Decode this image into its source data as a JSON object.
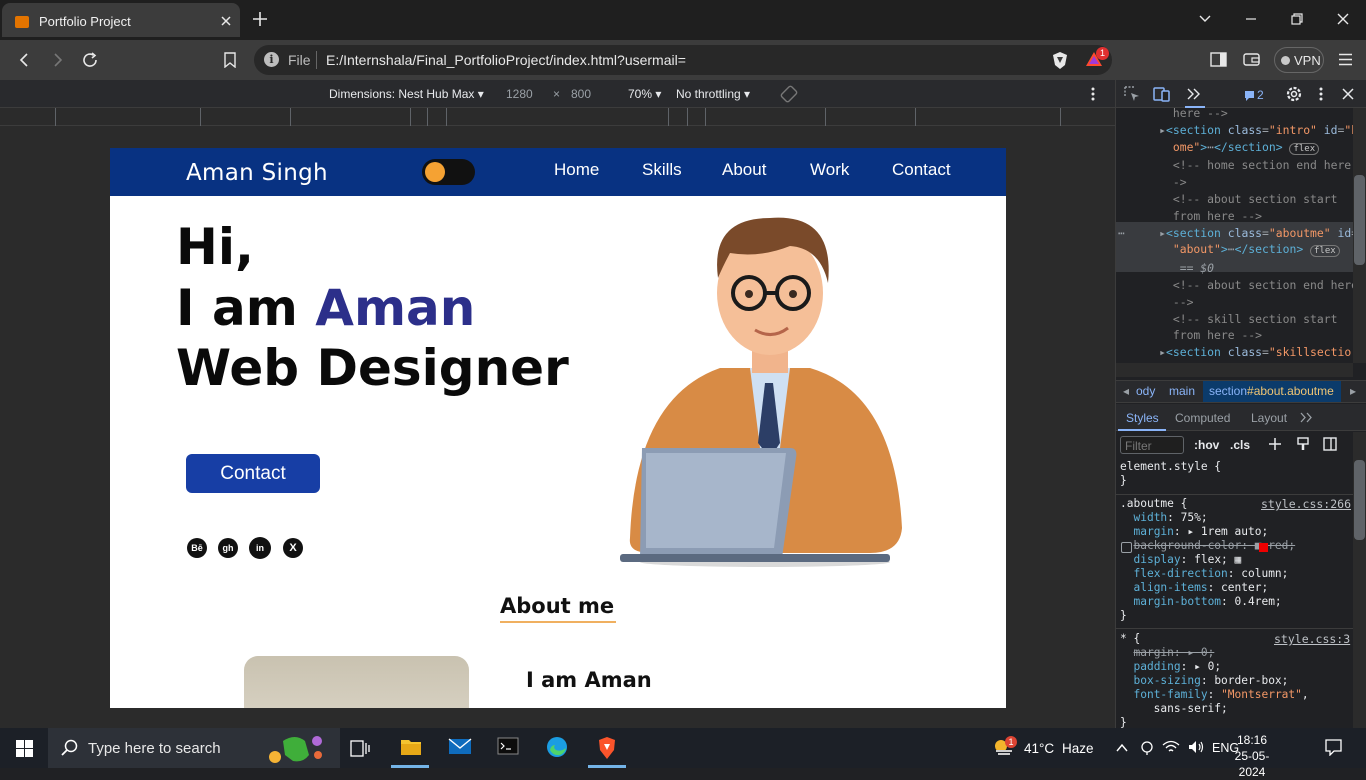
{
  "browser": {
    "tab_title": "Portfolio Project",
    "url_scheme": "File",
    "url": "E:/Internshala/Final_PortfolioProject/index.html?usermail=",
    "rewards_badge": "1",
    "vpn_label": "VPN"
  },
  "device_toolbar": {
    "dimensions_label": "Dimensions: Nest Hub Max",
    "width": "1280",
    "times": "×",
    "height": "800",
    "zoom": "70%",
    "throttling": "No throttling"
  },
  "site": {
    "logo": "Aman Singh",
    "nav": [
      "Home",
      "Skills",
      "About",
      "Work",
      "Contact"
    ],
    "hero_hi": "Hi,",
    "hero_iam_prefix": "I am ",
    "hero_name": "Aman",
    "hero_role": "Web Designer",
    "contact_button": "Contact",
    "social_icons": [
      "Bē",
      "gh",
      "in",
      "X"
    ],
    "about_heading": "About me",
    "about_subheading": "I am Aman"
  },
  "devtools": {
    "issues_count": "2",
    "breadcrumbs": [
      "ody",
      "main",
      "section",
      "#about.aboutme"
    ],
    "tabs": [
      "Styles",
      "Computed",
      "Layout"
    ],
    "filter_placeholder": "Filter",
    "hov": ":hov",
    "cls": ".cls",
    "dom_selected_marker": "== $0",
    "element_style": "element.style {",
    "rule1_selector": ".aboutme {",
    "rule1_source": "style.css:266",
    "rule2_selector": "* {",
    "rule2_source": "style.css:3"
  },
  "taskbar": {
    "search_placeholder": "Type here to search",
    "weather_temp": "41°C",
    "weather_desc": "Haze",
    "lang": "ENG",
    "time": "18:16",
    "date": "25-05-2024",
    "weather_badge": "1"
  },
  "colors": {
    "site_nav": "#083282",
    "hero_accent": "#2c2f8a",
    "contact_button": "#173ea5",
    "toggle_knob": "#f5a233"
  }
}
